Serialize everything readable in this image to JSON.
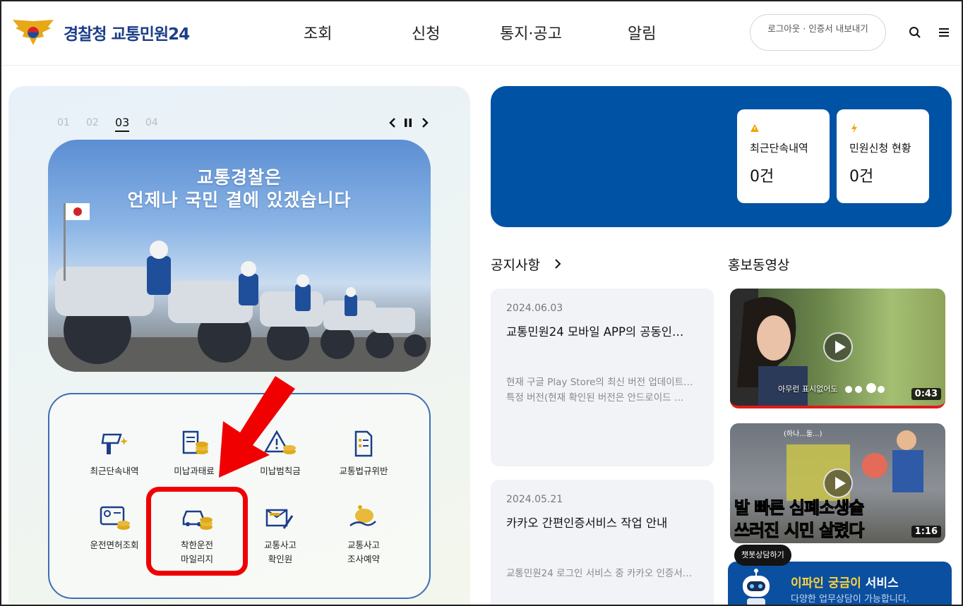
{
  "header": {
    "logo_text": "경찰청 교통민원24",
    "nav": [
      "조회",
      "신청",
      "통지·공고",
      "알림"
    ],
    "util_label": "로그아웃 · 인증서 내보내기",
    "search_icon": "search-icon",
    "menu_icon": "hamburger-menu-icon"
  },
  "slider": {
    "pages": [
      "01",
      "02",
      "03",
      "04"
    ],
    "active_index": 2,
    "banner_line1": "교통경찰은",
    "banner_line2": "언제나 국민 곁에 있겠습니다"
  },
  "quick_menu": {
    "row1": [
      "최근단속내역",
      "미납과태료",
      "미납범칙금",
      "교통법규위반"
    ],
    "row2": [
      {
        "line1": "운전면허조회",
        "line2": ""
      },
      {
        "line1": "착한운전",
        "line2": "마일리지"
      },
      {
        "line1": "교통사고",
        "line2": "확인원"
      },
      {
        "line1": "교통사고",
        "line2": "조사예약"
      }
    ]
  },
  "status": {
    "recent_label": "최근단속내역",
    "recent_value": "0건",
    "civil_label": "민원신청 현황",
    "civil_value": "0건"
  },
  "notice": {
    "title": "공지사항",
    "items": [
      {
        "date": "2024.06.03",
        "title": "교통민원24 모바일 APP의 공동인…",
        "body1": "현재 구글 Play Store의 최신 버전 업데이트…",
        "body2": "특정 버전(현재 확인된 버전은 안드로이드 …"
      },
      {
        "date": "2024.05.21",
        "title": "카카오 간편인증서비스 작업 안내",
        "body1": "교통민원24 로그인 서비스 중 카카오 인증서…",
        "body2": ""
      }
    ]
  },
  "videos": {
    "title": "홍보동영상",
    "items": [
      {
        "duration": "0:43",
        "caption": "아무런 표시없어도"
      },
      {
        "duration": "1:16",
        "caption_top": "발 빠른 심폐소생술",
        "caption_bottom": "쓰러진 시민 살렸다",
        "small": "(하나...둘...)"
      }
    ]
  },
  "chat": {
    "bubble": "챗봇상담하기",
    "title_hl": "이파인 궁금이",
    "title_rest": " 서비스",
    "sub": "다양한 업무상담이 가능합니다."
  },
  "colors": {
    "brand_blue": "#0052a4",
    "highlight_red": "#f00000"
  }
}
